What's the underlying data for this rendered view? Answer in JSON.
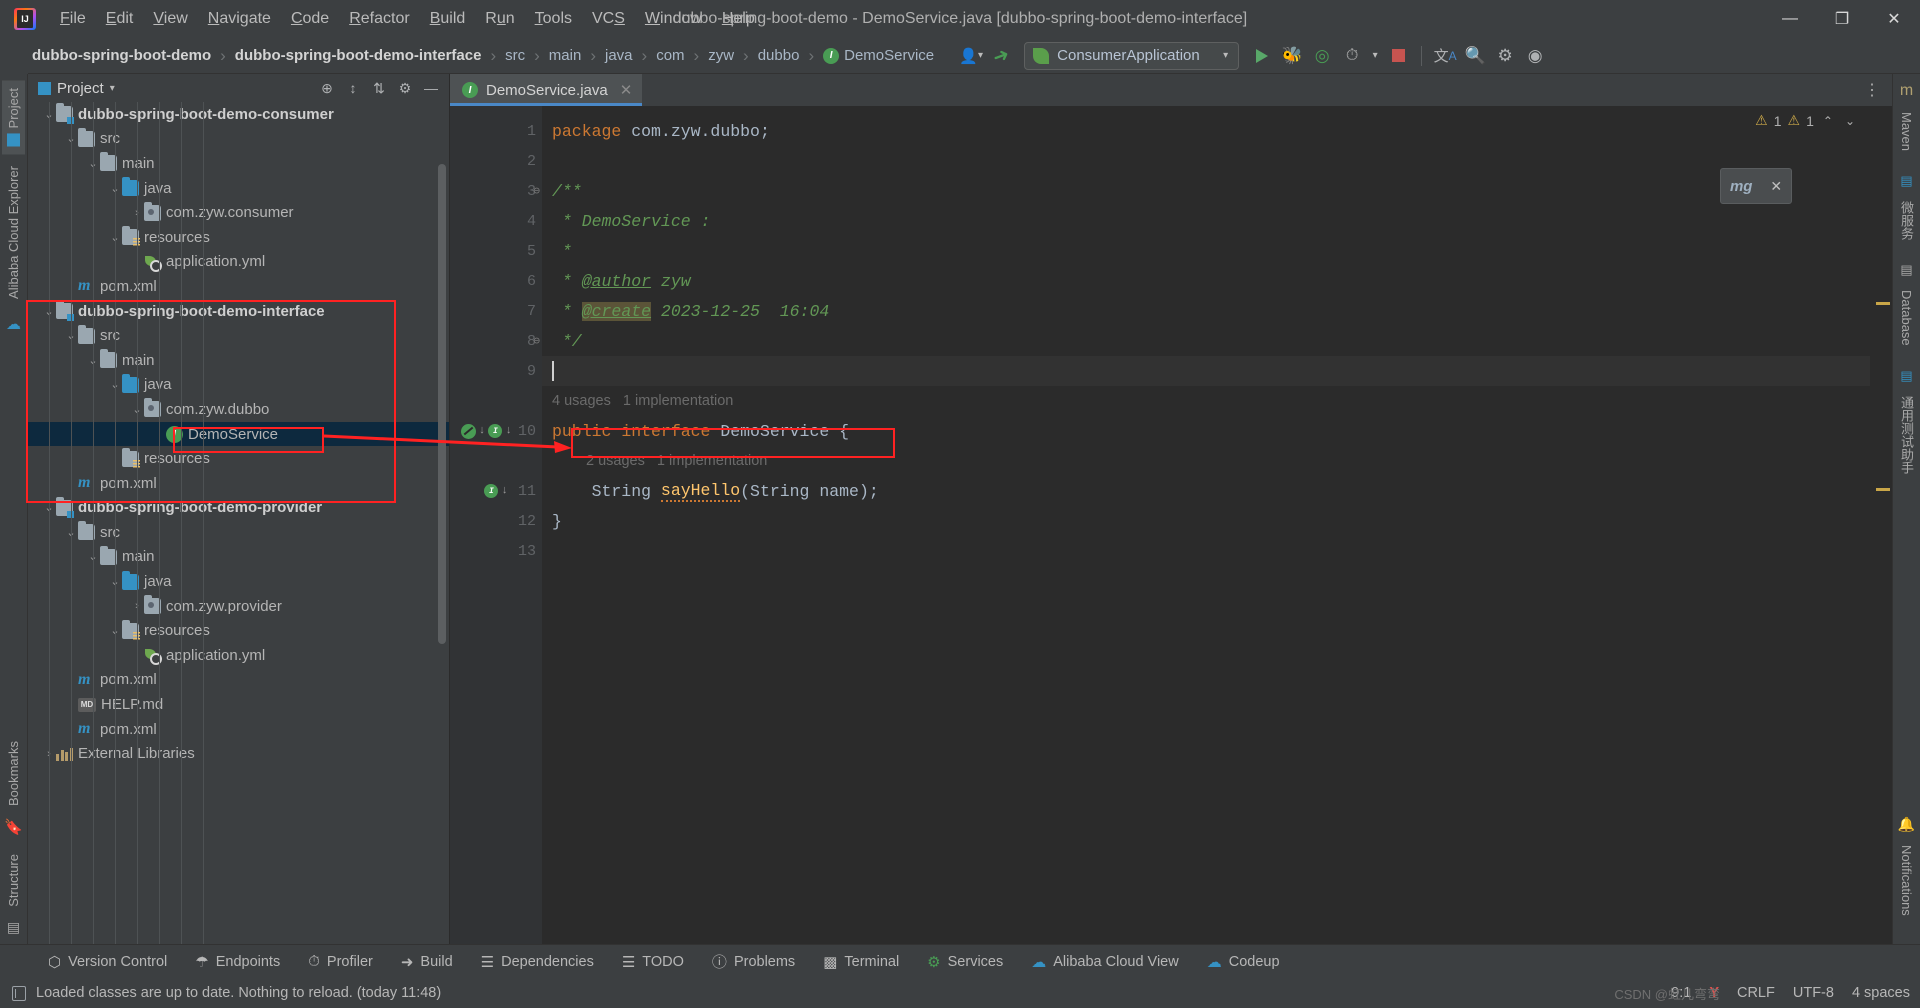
{
  "window": {
    "title": "dubbo-spring-boot-demo - DemoService.java [dubbo-spring-boot-demo-interface]",
    "minimize": "—",
    "maximize": "❐",
    "close": "✕",
    "logo_text": "IJ"
  },
  "menubar": {
    "items": [
      "File",
      "Edit",
      "View",
      "Navigate",
      "Code",
      "Refactor",
      "Build",
      "Run",
      "Tools",
      "VCS",
      "Window",
      "Help"
    ]
  },
  "navbar": {
    "breadcrumbs": [
      {
        "label": "dubbo-spring-boot-demo",
        "bold": true,
        "icon": ""
      },
      {
        "label": "dubbo-spring-boot-demo-interface",
        "bold": true,
        "icon": ""
      },
      {
        "label": "src",
        "bold": false,
        "icon": ""
      },
      {
        "label": "main",
        "bold": false,
        "icon": ""
      },
      {
        "label": "java",
        "bold": false,
        "icon": ""
      },
      {
        "label": "com",
        "bold": false,
        "icon": ""
      },
      {
        "label": "zyw",
        "bold": false,
        "icon": ""
      },
      {
        "label": "dubbo",
        "bold": false,
        "icon": ""
      },
      {
        "label": "DemoService",
        "bold": false,
        "icon": "interface-icon"
      }
    ],
    "separator": "›",
    "run_config": "ConsumerApplication",
    "icons": [
      "user-avatar-icon",
      "build-hammer-icon",
      "run-icon",
      "debug-icon",
      "run-coverage-icon",
      "profiler-icon",
      "stop-icon",
      "translate-icon",
      "search-icon",
      "settings-icon",
      "ide-assistant-icon"
    ]
  },
  "project_panel": {
    "title": "Project",
    "header_icons": [
      "locate-icon",
      "expand-all-icon",
      "collapse-all-icon",
      "settings-icon",
      "hide-icon"
    ],
    "tree": [
      {
        "depth": 1,
        "label": "dubbo-spring-boot-demo-consumer",
        "icon": "module-folder-icon",
        "arrow": "⌄",
        "bold": true,
        "selected": false
      },
      {
        "depth": 2,
        "label": "src",
        "icon": "folder-icon",
        "arrow": "⌄",
        "bold": false,
        "selected": false
      },
      {
        "depth": 3,
        "label": "main",
        "icon": "folder-icon",
        "arrow": "⌄",
        "bold": false,
        "selected": false
      },
      {
        "depth": 4,
        "label": "java",
        "icon": "source-folder-icon",
        "arrow": "⌄",
        "bold": false,
        "selected": false
      },
      {
        "depth": 5,
        "label": "com.zyw.consumer",
        "icon": "package-icon",
        "arrow": "›",
        "bold": false,
        "selected": false
      },
      {
        "depth": 4,
        "label": "resources",
        "icon": "resources-folder-icon",
        "arrow": "⌄",
        "bold": false,
        "selected": false
      },
      {
        "depth": 5,
        "label": "application.yml",
        "icon": "yaml-file-icon",
        "arrow": "",
        "bold": false,
        "selected": false
      },
      {
        "depth": 2,
        "label": "pom.xml",
        "icon": "maven-icon",
        "arrow": "",
        "bold": false,
        "selected": false
      },
      {
        "depth": 1,
        "label": "dubbo-spring-boot-demo-interface",
        "icon": "module-folder-icon",
        "arrow": "⌄",
        "bold": true,
        "selected": false
      },
      {
        "depth": 2,
        "label": "src",
        "icon": "folder-icon",
        "arrow": "⌄",
        "bold": false,
        "selected": false
      },
      {
        "depth": 3,
        "label": "main",
        "icon": "folder-icon",
        "arrow": "⌄",
        "bold": false,
        "selected": false
      },
      {
        "depth": 4,
        "label": "java",
        "icon": "source-folder-icon",
        "arrow": "⌄",
        "bold": false,
        "selected": false
      },
      {
        "depth": 5,
        "label": "com.zyw.dubbo",
        "icon": "package-icon",
        "arrow": "⌄",
        "bold": false,
        "selected": false
      },
      {
        "depth": 6,
        "label": "DemoService",
        "icon": "interface-icon",
        "arrow": "",
        "bold": false,
        "selected": true
      },
      {
        "depth": 4,
        "label": "resources",
        "icon": "resources-folder-icon",
        "arrow": "",
        "bold": false,
        "selected": false
      },
      {
        "depth": 2,
        "label": "pom.xml",
        "icon": "maven-icon",
        "arrow": "",
        "bold": false,
        "selected": false
      },
      {
        "depth": 1,
        "label": "dubbo-spring-boot-demo-provider",
        "icon": "module-folder-icon",
        "arrow": "⌄",
        "bold": true,
        "selected": false
      },
      {
        "depth": 2,
        "label": "src",
        "icon": "folder-icon",
        "arrow": "⌄",
        "bold": false,
        "selected": false
      },
      {
        "depth": 3,
        "label": "main",
        "icon": "folder-icon",
        "arrow": "⌄",
        "bold": false,
        "selected": false
      },
      {
        "depth": 4,
        "label": "java",
        "icon": "source-folder-icon",
        "arrow": "⌄",
        "bold": false,
        "selected": false
      },
      {
        "depth": 5,
        "label": "com.zyw.provider",
        "icon": "package-icon",
        "arrow": "›",
        "bold": false,
        "selected": false
      },
      {
        "depth": 4,
        "label": "resources",
        "icon": "resources-folder-icon",
        "arrow": "⌄",
        "bold": false,
        "selected": false
      },
      {
        "depth": 5,
        "label": "application.yml",
        "icon": "yaml-file-icon",
        "arrow": "",
        "bold": false,
        "selected": false
      },
      {
        "depth": 2,
        "label": "pom.xml",
        "icon": "maven-icon",
        "arrow": "",
        "bold": false,
        "selected": false
      },
      {
        "depth": 2,
        "label": "HELP.md",
        "icon": "markdown-icon",
        "arrow": "",
        "bold": false,
        "selected": false
      },
      {
        "depth": 2,
        "label": "pom.xml",
        "icon": "maven-icon",
        "arrow": "",
        "bold": false,
        "selected": false
      },
      {
        "depth": 1,
        "label": "External Libraries",
        "icon": "libraries-icon",
        "arrow": "›",
        "bold": false,
        "selected": false
      }
    ]
  },
  "left_strip": {
    "tabs": [
      {
        "label": "Project",
        "icon": "project-icon"
      },
      {
        "label": "Alibaba Cloud Explorer",
        "icon": "cloud-icon"
      },
      {
        "label": "Bookmarks",
        "icon": "bookmark-icon"
      },
      {
        "label": "Structure",
        "icon": "structure-icon"
      }
    ]
  },
  "right_strip": {
    "tabs": [
      {
        "label": "Maven",
        "icon": "maven-icon"
      },
      {
        "label": "微服务",
        "icon": "microservices-icon"
      },
      {
        "label": "Database",
        "icon": "database-icon"
      },
      {
        "label": "通用测试助手",
        "icon": "test-helper-icon"
      },
      {
        "label": "Notifications",
        "icon": "bell-icon"
      }
    ]
  },
  "editor": {
    "tab": {
      "label": "DemoService.java",
      "icon": "interface-icon",
      "close": "✕"
    },
    "warnings": {
      "error_count": "1",
      "warning_count": "1",
      "up": "⌃",
      "down": "⌄"
    },
    "float_widget": {
      "label": "mg",
      "close": "✕"
    },
    "lines": [
      {
        "num": "1",
        "segments": [
          {
            "t": "package ",
            "c": "kw"
          },
          {
            "t": "com.zyw.dubbo;",
            "c": "str"
          }
        ]
      },
      {
        "num": "2",
        "segments": []
      },
      {
        "num": "3",
        "segments": [
          {
            "t": "/**",
            "c": "cmt"
          }
        ],
        "fold": "⊖"
      },
      {
        "num": "4",
        "segments": [
          {
            "t": " * DemoService :",
            "c": "cmt"
          }
        ]
      },
      {
        "num": "5",
        "segments": [
          {
            "t": " *",
            "c": "cmt"
          }
        ]
      },
      {
        "num": "6",
        "segments": [
          {
            "t": " * ",
            "c": "cmt"
          },
          {
            "t": "@author",
            "c": "tag"
          },
          {
            "t": " zyw",
            "c": "cmt"
          }
        ]
      },
      {
        "num": "7",
        "segments": [
          {
            "t": " * ",
            "c": "cmt"
          },
          {
            "t": "@create",
            "c": "tag hl"
          },
          {
            "t": " 2023-12-25  16:04",
            "c": "cmt"
          }
        ]
      },
      {
        "num": "8",
        "segments": [
          {
            "t": " */",
            "c": "cmt"
          }
        ],
        "fold": "⊖"
      },
      {
        "num": "9",
        "segments": [],
        "current": true,
        "caret": true
      },
      {
        "num": "",
        "hint": "4 usages   1 implementation",
        "indent": 0
      },
      {
        "num": "10",
        "segments": [
          {
            "t": "public ",
            "c": "kw"
          },
          {
            "t": "interface ",
            "c": "kw"
          },
          {
            "t": "DemoService ",
            "c": "cls"
          },
          {
            "t": "{",
            "c": "str"
          }
        ],
        "gutter": "bean"
      },
      {
        "num": "",
        "hint": "2 usages   1 implementation",
        "indent": 1
      },
      {
        "num": "11",
        "segments": [
          {
            "t": "    String ",
            "c": "cls"
          },
          {
            "t": "sayHello",
            "c": "mth"
          },
          {
            "t": "(String name);",
            "c": "str"
          }
        ],
        "gutter": "impl",
        "boxed": true
      },
      {
        "num": "12",
        "segments": [
          {
            "t": "}",
            "c": "str"
          }
        ]
      },
      {
        "num": "13",
        "segments": []
      }
    ]
  },
  "toolwindows": {
    "items": [
      {
        "label": "Version Control",
        "icon": "branch-icon"
      },
      {
        "label": "Endpoints",
        "icon": "endpoints-icon"
      },
      {
        "label": "Profiler",
        "icon": "profiler-icon"
      },
      {
        "label": "Build",
        "icon": "hammer-icon"
      },
      {
        "label": "Dependencies",
        "icon": "dependencies-icon"
      },
      {
        "label": "TODO",
        "icon": "todo-icon"
      },
      {
        "label": "Problems",
        "icon": "problems-icon"
      },
      {
        "label": "Terminal",
        "icon": "terminal-icon"
      },
      {
        "label": "Services",
        "icon": "services-icon"
      },
      {
        "label": "Alibaba Cloud View",
        "icon": "cloud-view-icon"
      },
      {
        "label": "Codeup",
        "icon": "codeup-icon"
      }
    ]
  },
  "statusbar": {
    "message": "Loaded classes are up to date. Nothing to reload. (today 11:48)",
    "message_icon": "ide-icon",
    "caret_position": "9:1",
    "git_icon": "git-branch-icon",
    "line_separator": "CRLF",
    "encoding": "UTF-8",
    "indent": "4 spaces",
    "watermark": "CSDN @虹儿弯弯"
  }
}
